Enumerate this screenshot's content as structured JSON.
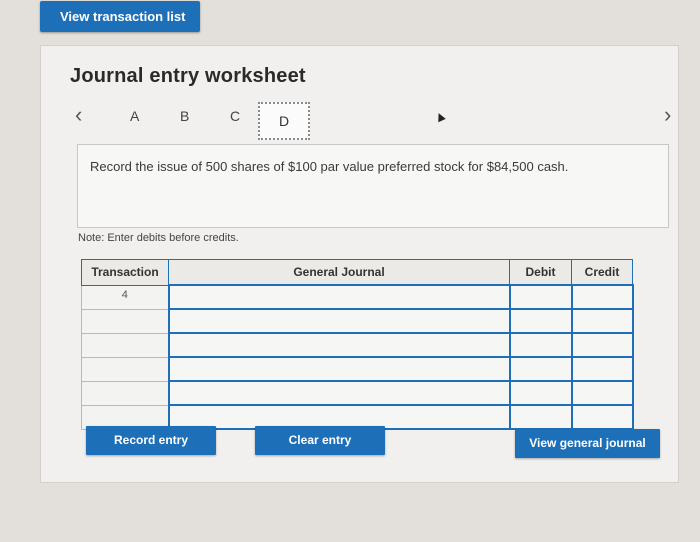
{
  "top": {
    "view_transaction_list": "View transaction list"
  },
  "worksheet": {
    "title": "Journal entry worksheet",
    "tabs": [
      "A",
      "B",
      "C",
      "D"
    ],
    "active_tab": "D",
    "prompt": "Record the issue of 500 shares of $100 par value preferred stock for $84,500 cash.",
    "note": "Note: Enter debits before credits."
  },
  "table": {
    "headers": {
      "transaction": "Transaction",
      "general_journal": "General Journal",
      "debit": "Debit",
      "credit": "Credit"
    },
    "rows": [
      {
        "transaction": "4"
      },
      {
        "transaction": ""
      },
      {
        "transaction": ""
      },
      {
        "transaction": ""
      },
      {
        "transaction": ""
      },
      {
        "transaction": ""
      }
    ]
  },
  "buttons": {
    "record_entry": "Record entry",
    "clear_entry": "Clear entry",
    "view_general_journal": "View general journal"
  },
  "colors": {
    "accent": "#1d6fb8"
  }
}
